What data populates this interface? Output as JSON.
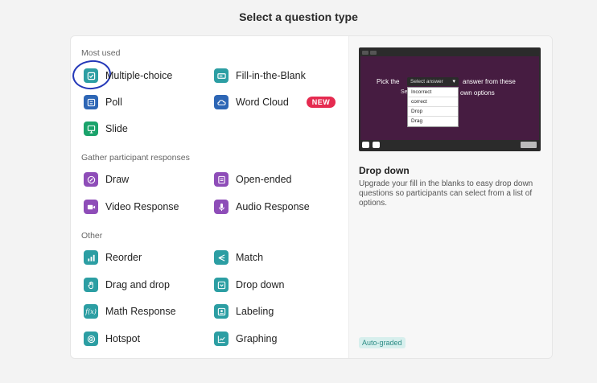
{
  "dialog": {
    "title": "Select a question type"
  },
  "sections": {
    "most_used": "Most used",
    "gather": "Gather participant responses",
    "other": "Other"
  },
  "items": {
    "multiple_choice": "Multiple-choice",
    "fill_blank": "Fill-in-the-Blank",
    "poll": "Poll",
    "word_cloud": "Word Cloud",
    "word_cloud_badge": "NEW",
    "slide": "Slide",
    "draw": "Draw",
    "open_ended": "Open-ended",
    "video_response": "Video Response",
    "audio_response": "Audio Response",
    "reorder": "Reorder",
    "match": "Match",
    "drag_and_drop": "Drag and drop",
    "drop_down": "Drop down",
    "math_response": "Math Response",
    "math_icon_text": "f(x)",
    "labeling": "Labeling",
    "hotspot": "Hotspot",
    "graphing": "Graphing"
  },
  "preview": {
    "text_before": "Pick the",
    "select_placeholder": "Select answer",
    "text_after": "answer from these",
    "text_hidden_left": "Se",
    "text_line2": "own options",
    "options": [
      "Incorrect",
      "correct",
      "Drop",
      "Drag"
    ]
  },
  "detail": {
    "title": "Drop down",
    "description": "Upgrade your fill in the blanks to easy drop down questions so participants can select from a list of options.",
    "badge": "Auto-graded"
  },
  "colors": {
    "teal": "#2c9ea3",
    "blue": "#2d66b5",
    "green": "#1aa36b",
    "purple": "#8e4db8",
    "preview_bg": "#461c41",
    "new_badge": "#e52b50"
  }
}
